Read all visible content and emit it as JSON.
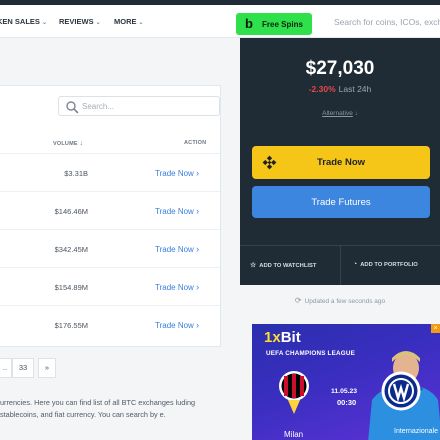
{
  "nav": {
    "items": [
      {
        "label": "KEN SALES",
        "chev": "⌄"
      },
      {
        "label": "REVIEWS",
        "chev": "⌄"
      },
      {
        "label": "MORE",
        "chev": "⌄"
      }
    ],
    "free_spins": {
      "logo": "b",
      "label": "Free Spins",
      "color": "#2ee14a"
    },
    "search_placeholder": "Search for coins, ICOs, exch"
  },
  "table": {
    "search_placeholder": "Search...",
    "col_volume": "VOLUME",
    "col_volume_sort": "↓",
    "col_action": "ACTION",
    "rows": [
      {
        "volume": "$3.31B",
        "action": "Trade Now"
      },
      {
        "volume": "$146.46M",
        "action": "Trade Now"
      },
      {
        "volume": "$342.45M",
        "action": "Trade Now"
      },
      {
        "volume": "$154.89M",
        "action": "Trade Now"
      },
      {
        "volume": "$176.55M",
        "action": "Trade Now"
      }
    ],
    "pagination": {
      "dots": "..",
      "last": "33",
      "next": "»"
    }
  },
  "description": "urrencies. Here you can find list of all BTC exchanges luding stablecoins, and fiat currency. You can search by e.",
  "price_panel": {
    "price": "$27,030",
    "change": "-2.30%",
    "change_label": "Last 24h",
    "alternative": "Alternative",
    "alternative_arrow": "↓",
    "trade_now": "Trade Now",
    "trade_futures": "Trade Futures",
    "add_watchlist": "ADD TO WATCHLIST",
    "add_portfolio": "ADD TO PORTFOLIO",
    "updated": "Updated a few seconds ago",
    "colors": {
      "panel": "#1f2b35",
      "trade": "#f5c518",
      "futures": "#3c86e0",
      "negative": "#e5484d"
    }
  },
  "ad": {
    "brand_one": "1x",
    "brand_rest": "Bit",
    "league": "UEFA CHAMPIONS LEAGUE",
    "date": "11.05.23",
    "time": "00:30",
    "team1": "Milan",
    "team2": "Internazionale",
    "close": "×"
  }
}
